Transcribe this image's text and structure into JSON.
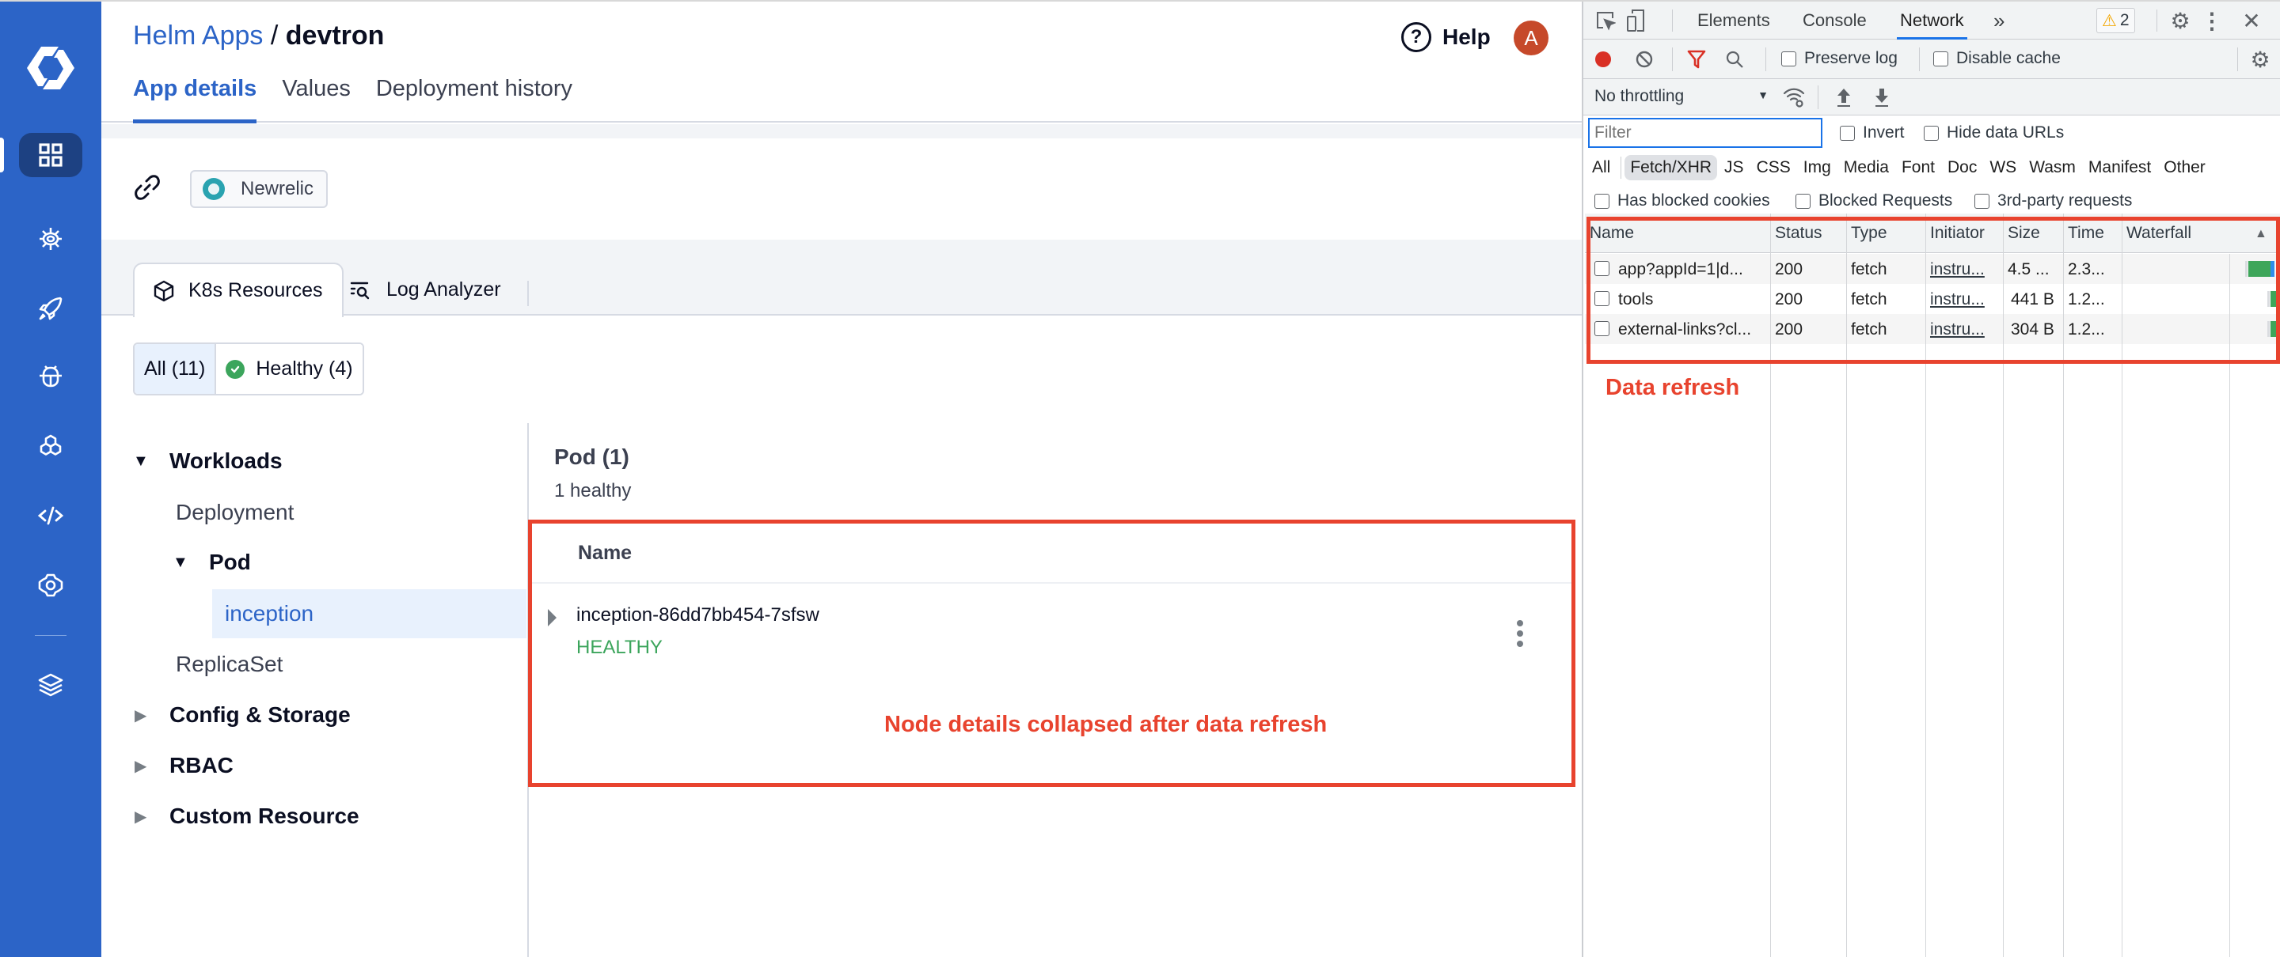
{
  "nav": {
    "items": [
      {
        "name": "apps",
        "icon": "grid-icon",
        "active": true
      },
      {
        "name": "helm-charts",
        "icon": "helm-wheel-icon"
      },
      {
        "name": "deployment-groups",
        "icon": "rocket-icon"
      },
      {
        "name": "security",
        "icon": "bug-icon"
      },
      {
        "name": "global-configurations",
        "icon": "hexagons-icon"
      },
      {
        "name": "code",
        "icon": "code-icon"
      },
      {
        "name": "settings",
        "icon": "gear-icon"
      },
      {
        "name": "stack",
        "icon": "layers-icon"
      }
    ]
  },
  "header": {
    "breadcrumb_link": "Helm Apps",
    "breadcrumb_sep": " / ",
    "breadcrumb_current": "devtron",
    "help_label": "Help",
    "avatar_initial": "A",
    "tabs": [
      {
        "label": "App details",
        "active": true
      },
      {
        "label": "Values"
      },
      {
        "label": "Deployment history"
      }
    ]
  },
  "external_links": {
    "chip_label": "Newrelic"
  },
  "resource_tabs": [
    {
      "label": "K8s Resources",
      "icon": "cube-icon",
      "active": true
    },
    {
      "label": "Log Analyzer",
      "icon": "log-search-icon"
    }
  ],
  "filters": [
    {
      "label": "All (11)",
      "active": true
    },
    {
      "label": "Healthy (4)",
      "icon": "check-circle-icon"
    }
  ],
  "tree": {
    "workloads": "Workloads",
    "deployment": "Deployment",
    "pod": "Pod",
    "inception": "inception",
    "replicaset": "ReplicaSet",
    "config_storage": "Config & Storage",
    "rbac": "RBAC",
    "custom_resource": "Custom Resource"
  },
  "pod_panel": {
    "title": "Pod (1)",
    "subtitle": "1 healthy",
    "column_name": "Name",
    "rows": [
      {
        "name": "inception-86dd7bb454-7sfsw",
        "status": "HEALTHY"
      }
    ]
  },
  "annotations": {
    "node": "Node details collapsed after data refresh",
    "data": "Data refresh",
    "color": "#e8432e"
  },
  "devtools": {
    "tabs": [
      "Elements",
      "Console",
      "Network"
    ],
    "active_tab": "Network",
    "more": "»",
    "warnings": "2",
    "preserve_log": "Preserve log",
    "disable_cache": "Disable cache",
    "throttling": "No throttling",
    "filter_placeholder": "Filter",
    "invert": "Invert",
    "hide_data_urls": "Hide data URLs",
    "types": [
      "All",
      "Fetch/XHR",
      "JS",
      "CSS",
      "Img",
      "Media",
      "Font",
      "Doc",
      "WS",
      "Wasm",
      "Manifest",
      "Other"
    ],
    "active_type": "Fetch/XHR",
    "blocked_cookies": "Has blocked cookies",
    "blocked_requests": "Blocked Requests",
    "third_party": "3rd-party requests",
    "columns": [
      "Name",
      "Status",
      "Type",
      "Initiator",
      "Size",
      "Time",
      "Waterfall"
    ],
    "requests": [
      {
        "name": "app?appId=1|d...",
        "status": "200",
        "type": "fetch",
        "initiator": "instru...",
        "size": "4.5 ...",
        "time": "2.3..."
      },
      {
        "name": "tools",
        "status": "200",
        "type": "fetch",
        "initiator": "instru...",
        "size": "441 B",
        "time": "1.2..."
      },
      {
        "name": "external-links?cl...",
        "status": "200",
        "type": "fetch",
        "initiator": "instru...",
        "size": "304 B",
        "time": "1.2..."
      }
    ]
  }
}
